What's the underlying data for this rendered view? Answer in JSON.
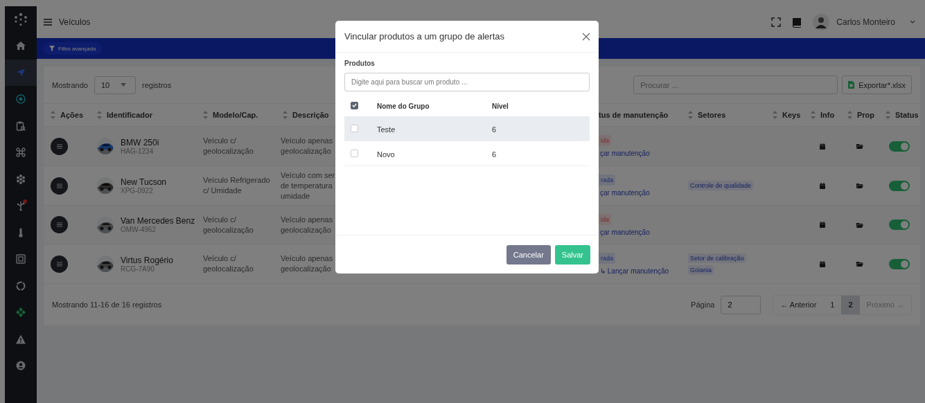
{
  "sidebar": {
    "items": [
      {
        "kind": "home",
        "selected": false,
        "notification": false
      },
      {
        "kind": "navigation",
        "selected": true,
        "notification": false
      },
      {
        "kind": "location",
        "selected": false,
        "notification": false
      },
      {
        "kind": "clipboard",
        "selected": false,
        "notification": false
      },
      {
        "kind": "command",
        "selected": false,
        "notification": false
      },
      {
        "kind": "cluster",
        "selected": false,
        "notification": false
      },
      {
        "kind": "network",
        "selected": false,
        "notification": true
      },
      {
        "kind": "thermometer",
        "selected": false,
        "notification": false
      },
      {
        "kind": "chip",
        "selected": false,
        "notification": false
      },
      {
        "kind": "ring",
        "selected": false,
        "notification": false
      },
      {
        "kind": "diamond",
        "selected": false,
        "notification": false
      },
      {
        "kind": "warning",
        "selected": false,
        "notification": false
      },
      {
        "kind": "user",
        "selected": false,
        "notification": false
      }
    ]
  },
  "header": {
    "title": "Veículos",
    "user": "Carlos Monteiro"
  },
  "filter_button": "Filtro avançado",
  "toolbar": {
    "show_label": "Mostrando",
    "page_size": "10",
    "records_label": "registros",
    "search_placeholder": "Procurar ...",
    "export_button": "Exportar*.xlsx"
  },
  "table": {
    "columns": [
      "Ações",
      "Identificador",
      "Modelo/Cap.",
      "Descrição",
      "Setores",
      "Keys",
      "Info",
      "Prop",
      "Status"
    ],
    "partial_column": "tus de manutenção",
    "rows": [
      {
        "name": "BMW 250i",
        "plate": "HAG-1234",
        "model": "Veículo c/ geolocalização",
        "description": "Veículo apenas\ngeolocalização",
        "maintenance": {
          "badge": "ida",
          "kind": "danger",
          "link": "çar manutenção"
        },
        "sectors": [],
        "status_on": true
      },
      {
        "name": "New Tucson",
        "plate": "XPG-0922",
        "model": "Veículo Refrigerado c/ Umidade",
        "description": "Veículo com ser\nde temperatura\numidade",
        "maintenance": {
          "badge": "rada",
          "kind": "info",
          "link": "çar manutenção"
        },
        "sectors": [
          "Controle de qualidade"
        ],
        "status_on": true
      },
      {
        "name": "Van Mercedes Benz",
        "plate": "OMW-4962",
        "model": "Veículo c/ geolocalização",
        "description": "Veículo apenas\ngeolocalização",
        "maintenance": {
          "badge": "ida",
          "kind": "danger",
          "link": "çar manutenção"
        },
        "sectors": [],
        "status_on": true
      },
      {
        "name": "Virtus Rogério",
        "plate": "RCG-7A90",
        "model": "Veículo c/ geolocalização",
        "description": "Veículo apenas\ngeolocalização",
        "maintenance": {
          "badge": "rada",
          "kind": "info",
          "link": "↳ Lançar manutenção"
        },
        "sectors": [
          "Setor de calibração",
          "Goiania"
        ],
        "status_on": true
      }
    ]
  },
  "footer": {
    "summary": "Mostrando 11-16 de 16 registros",
    "page_label": "Página",
    "page_value": "2",
    "pages": [
      {
        "label": "← Anterior",
        "selected": false,
        "disabled": false
      },
      {
        "label": "1",
        "selected": false,
        "disabled": false
      },
      {
        "label": "2",
        "selected": true,
        "disabled": false
      },
      {
        "label": "Próximo →",
        "selected": false,
        "disabled": true
      }
    ]
  },
  "modal": {
    "title": "Vincular produtos a um grupo de alertas",
    "field_label": "Produtos",
    "search_placeholder": "Digite aqui para buscar um produto ...",
    "columns": [
      "Nome do Grupo",
      "Nível"
    ],
    "all_checked": true,
    "rows": [
      {
        "name": "Teste",
        "level": "6",
        "checked": false,
        "highlighted": true
      },
      {
        "name": "Novo",
        "level": "6",
        "checked": false,
        "highlighted": false
      }
    ],
    "buttons": [
      {
        "label": "Cancelar",
        "kind": "secondary"
      },
      {
        "label": "Salvar",
        "kind": "primary"
      }
    ]
  }
}
